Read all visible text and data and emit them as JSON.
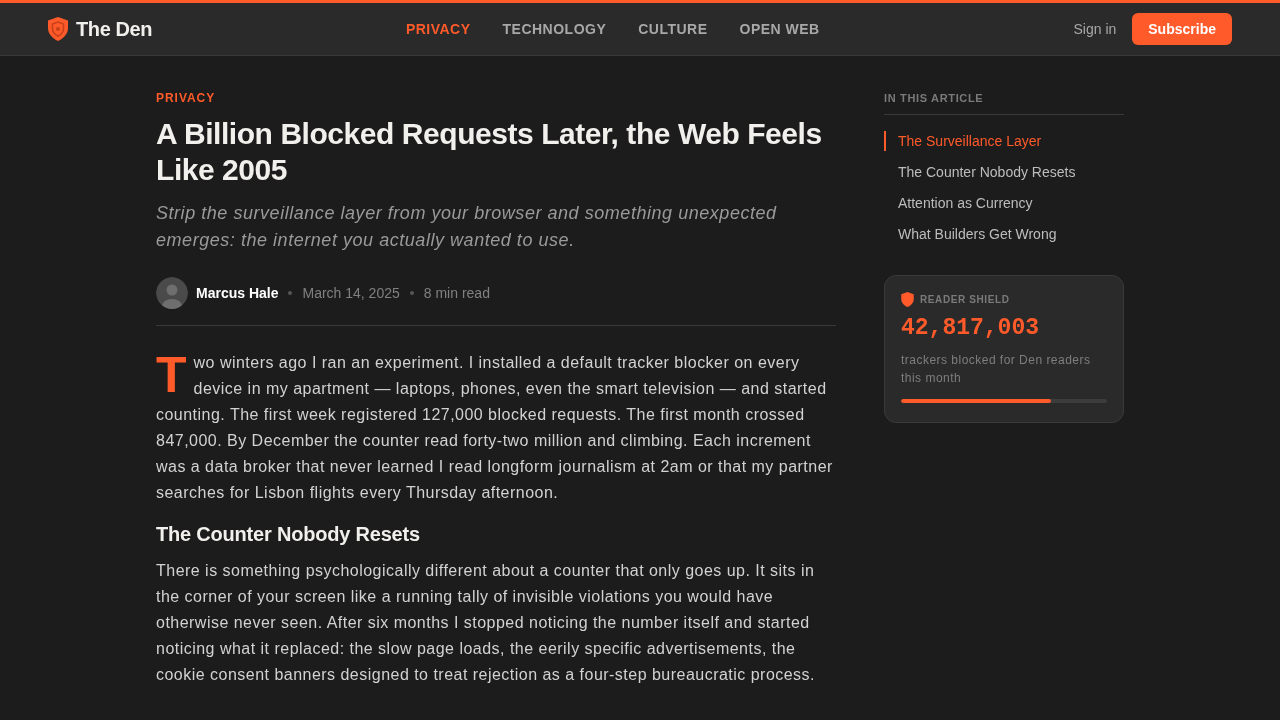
{
  "brand": {
    "name": "The Den"
  },
  "nav": [
    {
      "label": "PRIVACY",
      "selected": true
    },
    {
      "label": "TECHNOLOGY",
      "selected": false
    },
    {
      "label": "CULTURE",
      "selected": false
    },
    {
      "label": "OPEN WEB",
      "selected": false
    }
  ],
  "header_actions": {
    "sign_in": "Sign in",
    "subscribe": "Subscribe"
  },
  "article": {
    "category": "PRIVACY",
    "title": "A Billion Blocked Requests Later, the Web Feels Like 2005",
    "subtitle": "Strip the surveillance layer from your browser and something unexpected emerges: the internet you actually wanted to use.",
    "byline": {
      "author": "Marcus Hale",
      "date": "March 14, 2025",
      "read_time": "8 min read"
    },
    "blocks": [
      {
        "kind": "paragraph",
        "drop_cap": "T",
        "text": "wo winters ago I ran an experiment. I installed a default tracker blocker on every device in my apartment — laptops, phones, even the smart television — and started counting. The first week registered 127,000 blocked requests. The first month crossed 847,000. By December the counter read forty-two million and climbing. Each increment was a data broker that never learned I read longform journalism at 2am or that my partner searches for Lisbon flights every Thursday afternoon."
      },
      {
        "kind": "heading",
        "text": "The Counter Nobody Resets"
      },
      {
        "kind": "paragraph",
        "text": "There is something psychologically different about a counter that only goes up. It sits in the corner of your screen like a running tally of invisible violations you would have otherwise never seen. After six months I stopped noticing the number itself and started noticing what it replaced: the slow page loads, the eerily specific advertisements, the cookie consent banners designed to treat rejection as a four-step bureaucratic process."
      }
    ]
  },
  "sidebar": {
    "toc": {
      "title": "IN THIS ARTICLE",
      "items": [
        {
          "label": "The Surveillance Layer",
          "selected": true
        },
        {
          "label": "The Counter Nobody Resets",
          "selected": false
        },
        {
          "label": "Attention as Currency",
          "selected": false
        },
        {
          "label": "What Builders Get Wrong",
          "selected": false
        }
      ]
    },
    "shield_card": {
      "title": "READER SHIELD",
      "count": "42,817,003",
      "caption": "trackers blocked for Den readers this month",
      "level": 0.73
    }
  }
}
